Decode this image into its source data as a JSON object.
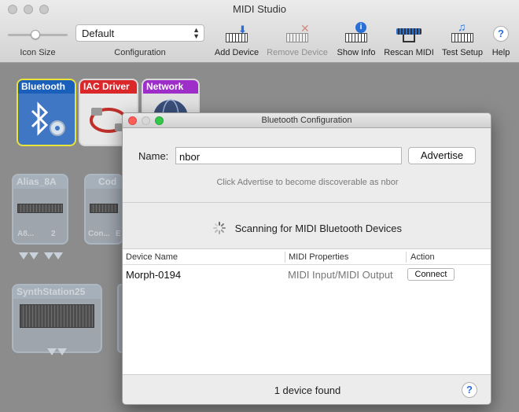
{
  "window": {
    "title": "MIDI Studio"
  },
  "toolbar": {
    "icon_size_label": "Icon Size",
    "icon_size_level": 0.45,
    "configuration_label": "Configuration",
    "configuration_value": "Default",
    "add_device": "Add Device",
    "remove_device": "Remove Device",
    "show_info": "Show Info",
    "rescan_midi": "Rescan MIDI",
    "test_setup": "Test Setup",
    "help": "Help",
    "help_glyph": "?"
  },
  "devices": [
    {
      "name": "Bluetooth",
      "color": "#1a5fb9",
      "selected": true
    },
    {
      "name": "IAC Driver",
      "color": "#d9272a"
    },
    {
      "name": "Network",
      "color": "#9d2fc8"
    },
    {
      "name": "Alias_8A",
      "ports": [
        "A8...",
        "2"
      ],
      "offline": true
    },
    {
      "name": "Cod",
      "ports": [
        "Con...",
        "E"
      ],
      "offline": true
    },
    {
      "name": "SynthStation25",
      "offline": true
    }
  ],
  "dialog": {
    "title": "Bluetooth Configuration",
    "name_label": "Name:",
    "name_value": "nbor",
    "advertise_button": "Advertise",
    "hint": "Click Advertise to become discoverable as nbor",
    "scanning_text": "Scanning for MIDI Bluetooth Devices",
    "columns": [
      "Device Name",
      "MIDI Properties",
      "Action"
    ],
    "rows": [
      {
        "device_name": "Morph-0194",
        "properties": "MIDI Input/MIDI Output",
        "action": "Connect"
      }
    ],
    "footer_count": "1 device found",
    "help_glyph": "?"
  }
}
